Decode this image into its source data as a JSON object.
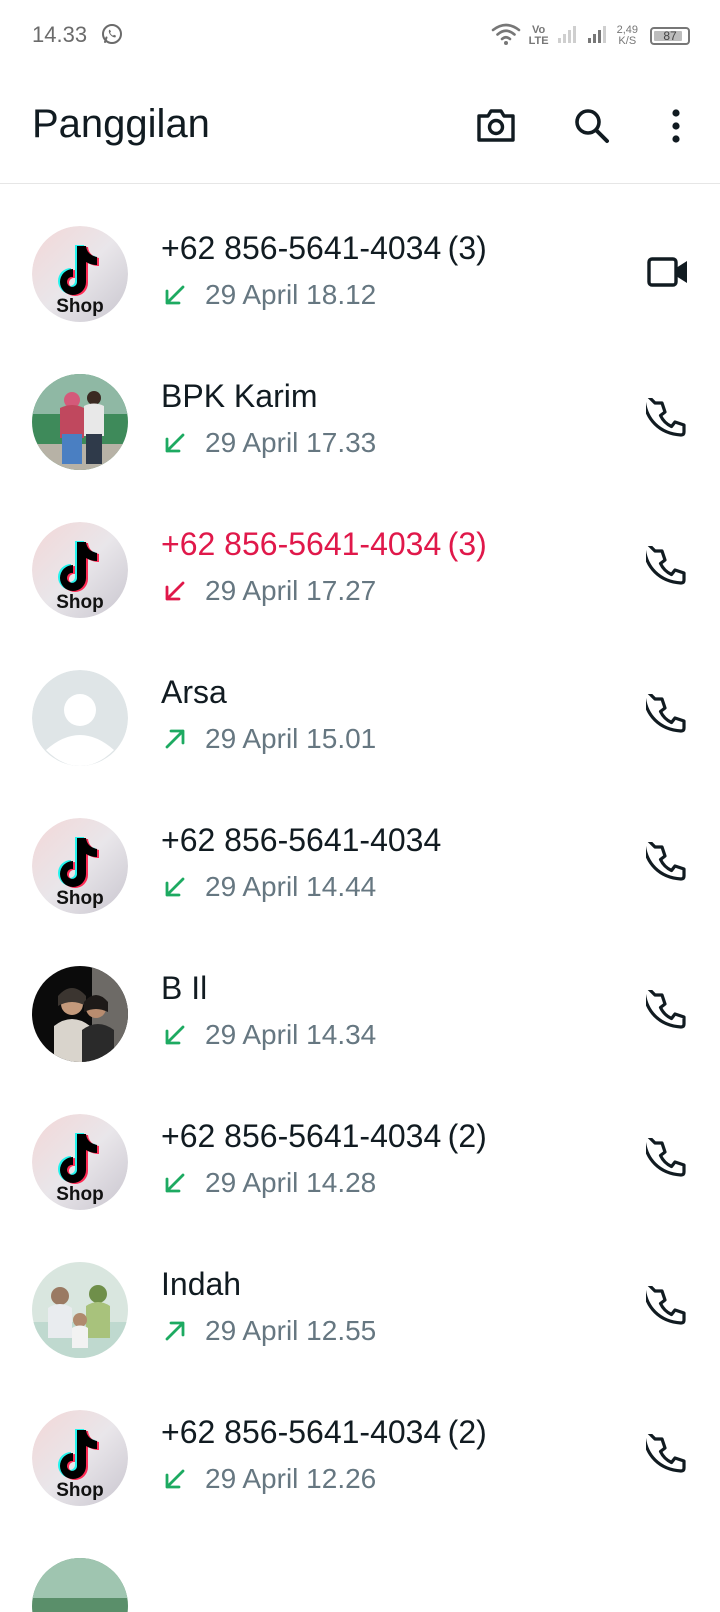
{
  "status_bar": {
    "time": "14.33",
    "network_label_top": "Vo",
    "network_label_bottom": "LTE",
    "speed_value": "2,49",
    "speed_unit": "K/S",
    "battery": "87",
    "battery_level": 0.87,
    "icons": [
      "whatsapp-notification-icon",
      "wifi-icon",
      "signal-sim1-icon",
      "signal-sim2-icon",
      "battery-icon"
    ]
  },
  "app_bar": {
    "title": "Panggilan",
    "actions": [
      "camera-icon",
      "search-icon",
      "more-options-icon"
    ]
  },
  "colors": {
    "incoming_arrow": "#1daa61",
    "outgoing_arrow": "#1daa61",
    "missed": "#e0184a",
    "subtitle": "#667781",
    "title": "#111b21"
  },
  "calls": [
    {
      "name": "+62 856-5641-4034 (3)",
      "time": "29 April 18.12",
      "direction": "incoming",
      "missed": false,
      "type": "video",
      "avatar": "tiktok-shop"
    },
    {
      "name": "BPK Karim",
      "time": "29 April 17.33",
      "direction": "incoming",
      "missed": false,
      "type": "voice",
      "avatar": "photo-couple"
    },
    {
      "name": "+62 856-5641-4034 (3)",
      "time": "29 April 17.27",
      "direction": "incoming",
      "missed": true,
      "type": "voice",
      "avatar": "tiktok-shop"
    },
    {
      "name": "Arsa",
      "time": "29 April 15.01",
      "direction": "outgoing",
      "missed": false,
      "type": "voice",
      "avatar": "default"
    },
    {
      "name": "+62 856-5641-4034",
      "time": "29 April 14.44",
      "direction": "incoming",
      "missed": false,
      "type": "voice",
      "avatar": "tiktok-shop"
    },
    {
      "name": "B Il",
      "time": "29 April 14.34",
      "direction": "incoming",
      "missed": false,
      "type": "voice",
      "avatar": "photo-dark"
    },
    {
      "name": "+62 856-5641-4034 (2)",
      "time": "29 April 14.28",
      "direction": "incoming",
      "missed": false,
      "type": "voice",
      "avatar": "tiktok-shop"
    },
    {
      "name": "Indah",
      "time": "29 April 12.55",
      "direction": "outgoing",
      "missed": false,
      "type": "voice",
      "avatar": "photo-family"
    },
    {
      "name": "+62 856-5641-4034 (2)",
      "time": "29 April 12.26",
      "direction": "incoming",
      "missed": false,
      "type": "voice",
      "avatar": "tiktok-shop"
    },
    {
      "name": "",
      "time": "",
      "direction": "incoming",
      "missed": false,
      "type": "voice",
      "avatar": "photo-partial"
    }
  ]
}
